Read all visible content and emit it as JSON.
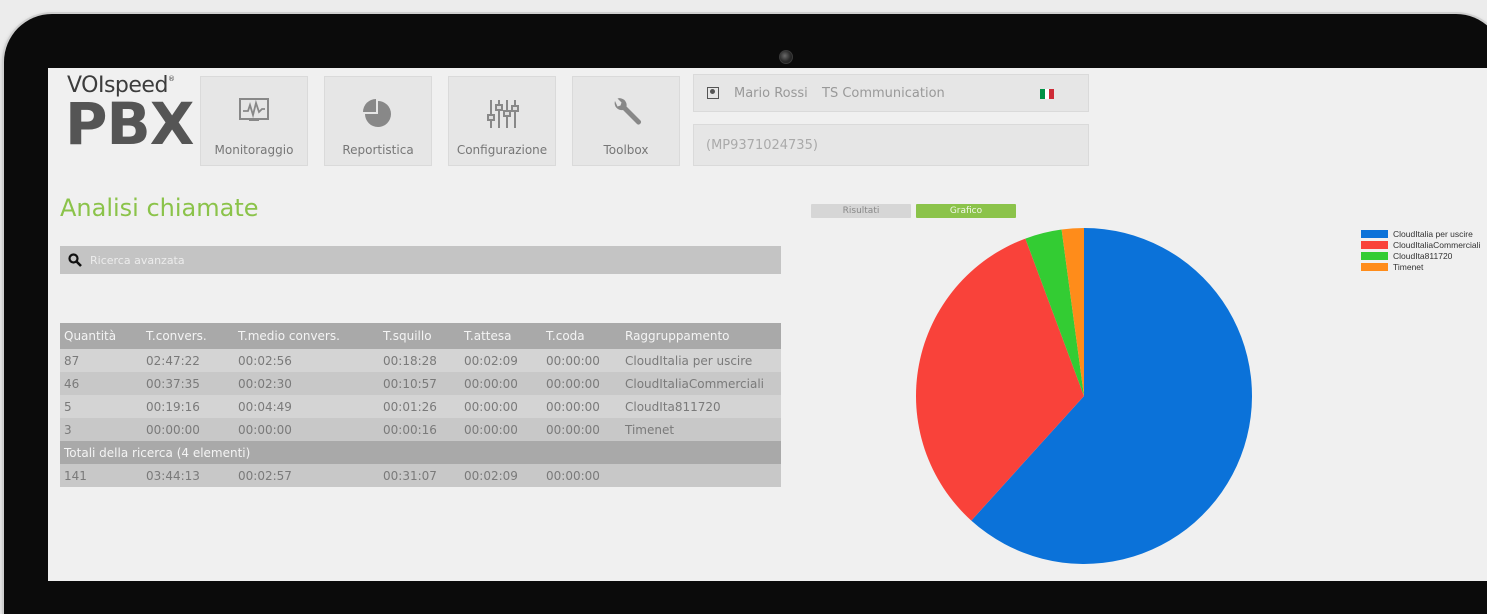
{
  "app": {
    "brand": "VOIspeed",
    "brand_mark": "®",
    "product": "PBX"
  },
  "nav": [
    {
      "label": "Monitoraggio",
      "icon": "monitor-chart-icon"
    },
    {
      "label": "Reportistica",
      "icon": "pie-chart-icon"
    },
    {
      "label": "Configurazione",
      "icon": "sliders-icon"
    },
    {
      "label": "Toolbox",
      "icon": "wrench-icon"
    }
  ],
  "user": {
    "name": "Mario Rossi",
    "company": "TS Communication",
    "code": "(MP9371024735)",
    "flag_colors": [
      "#009246",
      "#ffffff",
      "#ce2b37"
    ]
  },
  "page": {
    "title": "Analisi chiamate",
    "search_label": "Ricerca avanzata"
  },
  "table": {
    "headers": [
      "Quantità",
      "T.convers.",
      "T.medio convers.",
      "T.squillo",
      "T.attesa",
      "T.coda",
      "Raggruppamento"
    ],
    "rows": [
      [
        "87",
        "02:47:22",
        "00:02:56",
        "00:18:28",
        "00:02:09",
        "00:00:00",
        "CloudItalia per uscire"
      ],
      [
        "46",
        "00:37:35",
        "00:02:30",
        "00:10:57",
        "00:00:00",
        "00:00:00",
        "CloudItaliaCommerciali"
      ],
      [
        "5",
        "00:19:16",
        "00:04:49",
        "00:01:26",
        "00:00:00",
        "00:00:00",
        "CloudIta811720"
      ],
      [
        "3",
        "00:00:00",
        "00:00:00",
        "00:00:16",
        "00:00:00",
        "00:00:00",
        "Timenet"
      ]
    ],
    "totals_label": "Totali della ricerca (4 elementi)",
    "totals": [
      "141",
      "03:44:13",
      "00:02:57",
      "00:31:07",
      "00:02:09",
      "00:00:00",
      ""
    ]
  },
  "tabs": {
    "results": "Risultati",
    "chart": "Grafico"
  },
  "colors": {
    "accent": "#8bc34a"
  },
  "chart_data": {
    "type": "pie",
    "categories": [
      "CloudItalia per uscire",
      "CloudItaliaCommerciali",
      "CloudIta811720",
      "Timenet"
    ],
    "values": [
      87,
      46,
      5,
      3
    ],
    "colors": [
      "#0b72d9",
      "#f9423a",
      "#33cc33",
      "#ff8c1a"
    ],
    "legend_position": "top-right"
  }
}
